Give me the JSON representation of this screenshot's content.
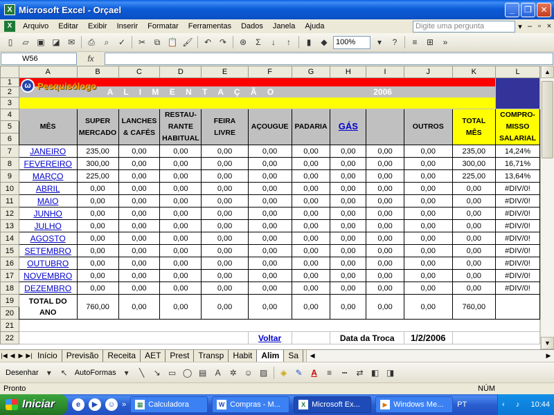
{
  "window": {
    "title": "Microsoft Excel - Orçael"
  },
  "menu": {
    "items": [
      "Arquivo",
      "Editar",
      "Exibir",
      "Inserir",
      "Formatar",
      "Ferramentas",
      "Dados",
      "Janela",
      "Ajuda"
    ],
    "help_placeholder": "Digite uma pergunta"
  },
  "toolbar": {
    "zoom": "100%"
  },
  "formula": {
    "name_box": "W56",
    "fx": "fx",
    "value": ""
  },
  "columns": [
    "A",
    "B",
    "C",
    "D",
    "E",
    "F",
    "G",
    "H",
    "I",
    "J",
    "K",
    "L"
  ],
  "banner": {
    "logo": "Pesquisólogo",
    "title": "A L I M E N T A Ç Ã O",
    "year": "2006"
  },
  "headers": {
    "mes": "MÊS",
    "super": "SUPER MERCADO",
    "lanches": "LANCHES & CAFÉS",
    "restaurante": "RESTAU-RANTE HABITUAL",
    "feira": "FEIRA LIVRE",
    "acougue": "AÇOUGUE",
    "padaria": "PADARIA",
    "gas": "GÁS",
    "blank": "",
    "outros": "OUTROS",
    "total": "TOTAL MÊS",
    "compromisso": "COMPRO-MISSO SALARIAL"
  },
  "rows": [
    {
      "n": "7",
      "month": "JANEIRO",
      "values": [
        "235,00",
        "0,00",
        "0,00",
        "0,00",
        "0,00",
        "0,00",
        "0,00",
        "0,00",
        "0,00",
        "235,00",
        "14,24%"
      ]
    },
    {
      "n": "8",
      "month": "FEVEREIRO",
      "values": [
        "300,00",
        "0,00",
        "0,00",
        "0,00",
        "0,00",
        "0,00",
        "0,00",
        "0,00",
        "0,00",
        "300,00",
        "16,71%"
      ]
    },
    {
      "n": "9",
      "month": "MARÇO",
      "values": [
        "225,00",
        "0,00",
        "0,00",
        "0,00",
        "0,00",
        "0,00",
        "0,00",
        "0,00",
        "0,00",
        "225,00",
        "13,64%"
      ]
    },
    {
      "n": "10",
      "month": "ABRIL",
      "values": [
        "0,00",
        "0,00",
        "0,00",
        "0,00",
        "0,00",
        "0,00",
        "0,00",
        "0,00",
        "0,00",
        "0,00",
        "#DIV/0!"
      ]
    },
    {
      "n": "11",
      "month": "MAIO",
      "values": [
        "0,00",
        "0,00",
        "0,00",
        "0,00",
        "0,00",
        "0,00",
        "0,00",
        "0,00",
        "0,00",
        "0,00",
        "#DIV/0!"
      ]
    },
    {
      "n": "12",
      "month": "JUNHO",
      "values": [
        "0,00",
        "0,00",
        "0,00",
        "0,00",
        "0,00",
        "0,00",
        "0,00",
        "0,00",
        "0,00",
        "0,00",
        "#DIV/0!"
      ]
    },
    {
      "n": "13",
      "month": "JULHO",
      "values": [
        "0,00",
        "0,00",
        "0,00",
        "0,00",
        "0,00",
        "0,00",
        "0,00",
        "0,00",
        "0,00",
        "0,00",
        "#DIV/0!"
      ]
    },
    {
      "n": "14",
      "month": "AGOSTO",
      "values": [
        "0,00",
        "0,00",
        "0,00",
        "0,00",
        "0,00",
        "0,00",
        "0,00",
        "0,00",
        "0,00",
        "0,00",
        "#DIV/0!"
      ]
    },
    {
      "n": "15",
      "month": "SETEMBRO",
      "values": [
        "0,00",
        "0,00",
        "0,00",
        "0,00",
        "0,00",
        "0,00",
        "0,00",
        "0,00",
        "0,00",
        "0,00",
        "#DIV/0!"
      ]
    },
    {
      "n": "16",
      "month": "OUTUBRO",
      "values": [
        "0,00",
        "0,00",
        "0,00",
        "0,00",
        "0,00",
        "0,00",
        "0,00",
        "0,00",
        "0,00",
        "0,00",
        "#DIV/0!"
      ]
    },
    {
      "n": "17",
      "month": "NOVEMBRO",
      "values": [
        "0,00",
        "0,00",
        "0,00",
        "0,00",
        "0,00",
        "0,00",
        "0,00",
        "0,00",
        "0,00",
        "0,00",
        "#DIV/0!"
      ]
    },
    {
      "n": "18",
      "month": "DEZEMBRO",
      "values": [
        "0,00",
        "0,00",
        "0,00",
        "0,00",
        "0,00",
        "0,00",
        "0,00",
        "0,00",
        "0,00",
        "0,00",
        "#DIV/0!"
      ]
    }
  ],
  "total_row": {
    "label": "TOTAL DO ANO",
    "values": [
      "760,00",
      "0,00",
      "0,00",
      "0,00",
      "0,00",
      "0,00",
      "0,00",
      "0,00",
      "0,00",
      "760,00",
      ""
    ]
  },
  "footer_row": {
    "voltar": "Voltar",
    "data_label": "Data da Troca",
    "data_value": "1/2/2006"
  },
  "sheet_tabs": [
    "Início",
    "Previsão",
    "Receita",
    "AET",
    "Prest",
    "Transp",
    "Habit",
    "Alim",
    "Sa"
  ],
  "active_tab": "Alim",
  "drawbar": {
    "desenhar": "Desenhar",
    "autoformas": "AutoFormas"
  },
  "status": {
    "ready": "Pronto",
    "num": "NÚM"
  },
  "taskbar": {
    "start": "Iniciar",
    "tasks": [
      "Calculadora",
      "Compras - M...",
      "Microsoft Ex...",
      "Windows Me..."
    ],
    "lang": "PT",
    "clock": "10:44"
  },
  "colors": {
    "banner_red": "#ff0000",
    "header_yellow": "#ffff00",
    "corner_navy": "#333399",
    "xp_blue": "#0a5ee0"
  }
}
